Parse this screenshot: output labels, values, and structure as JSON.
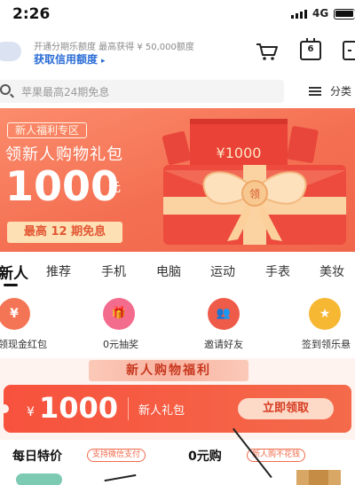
{
  "status_bar": {
    "time": "2:26",
    "network": "4G"
  },
  "credit": {
    "line1": "开通分期乐额度 最高获得 ¥ 50,000额度",
    "line2": "获取信用额度",
    "arrow": "▸",
    "calendar_day": "6"
  },
  "search": {
    "placeholder": "苹果最高24期免息",
    "category_label": "分类"
  },
  "banner": {
    "tag": "新人福利专区",
    "title": "领新人购物礼包",
    "amount": "1000",
    "unit": "元",
    "installment": "最高 12 期免息",
    "envelope_amount": "¥1000",
    "envelope_seal": "领",
    "colors": {
      "primary": "#f46f52",
      "accent": "#fde0b4"
    }
  },
  "tabs": [
    {
      "label": "新人"
    },
    {
      "label": "推荐"
    },
    {
      "label": "手机"
    },
    {
      "label": "电脑"
    },
    {
      "label": "运动"
    },
    {
      "label": "手表"
    },
    {
      "label": "美妆"
    }
  ],
  "quick_entries": [
    {
      "label": "领现金红包",
      "icon": "red-envelope-icon",
      "glyph": "¥",
      "color": "#f47556"
    },
    {
      "label": "0元抽奖",
      "icon": "gift-box-icon",
      "glyph": "🎁",
      "color": "#f36b8d"
    },
    {
      "label": "邀请好友",
      "icon": "friends-icon",
      "glyph": "👥",
      "color": "#ef5b49"
    },
    {
      "label": "签到领乐悬",
      "icon": "star-icon",
      "glyph": "★",
      "color": "#f6b733"
    }
  ],
  "promo": {
    "ribbon": "新人购物福利",
    "currency": "¥",
    "value": "1000",
    "gift_label": "新人礼包",
    "button": "立即领取"
  },
  "daily_deal": {
    "title": "每日特价",
    "chip": "支持微信支付"
  },
  "zero_buy": {
    "title": "0元购",
    "chip": "新人购不花钱"
  }
}
